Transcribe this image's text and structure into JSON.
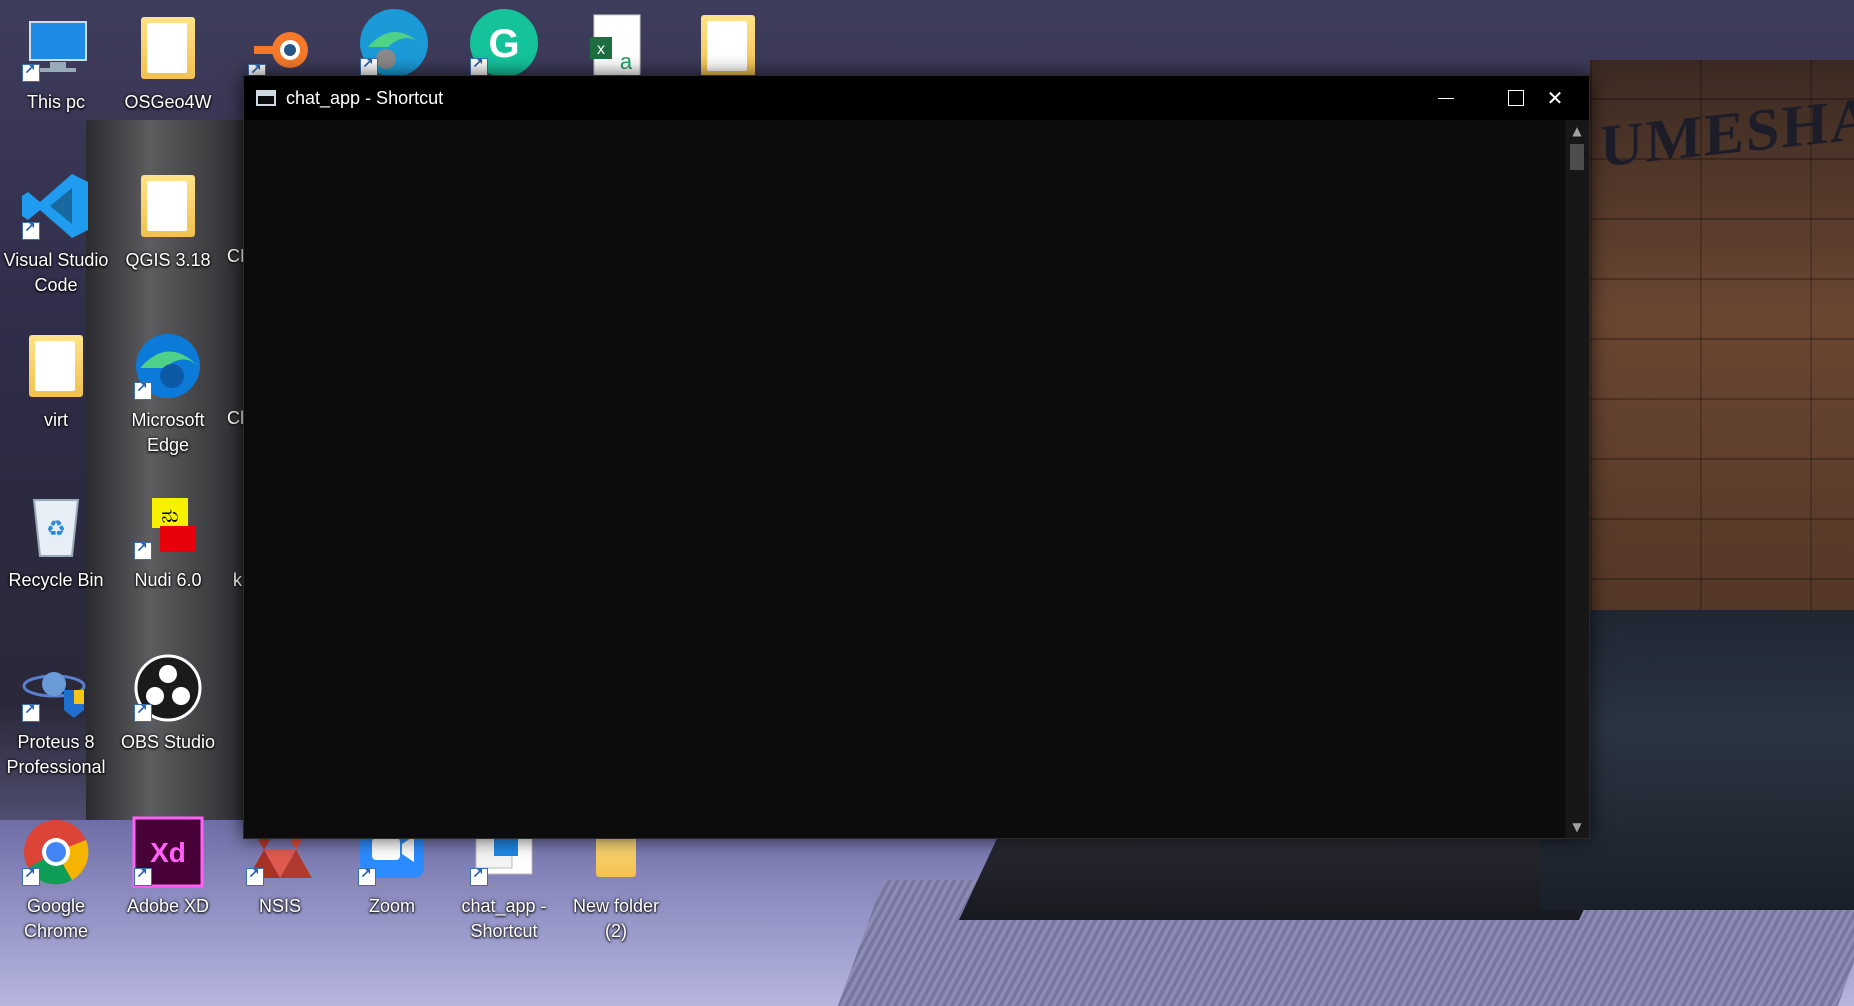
{
  "desktop": {
    "wallpaper_text": "UMESHA R",
    "icons": [
      {
        "label": "This pc",
        "icon": "monitor-icon"
      },
      {
        "label": "OSGeo4W",
        "icon": "folder-icon"
      },
      {
        "label": "Visual Studio Code",
        "icon": "vscode-icon"
      },
      {
        "label": "QGIS 3.18",
        "icon": "folder-icon"
      },
      {
        "label": "virt",
        "icon": "folder-icon"
      },
      {
        "label": "Microsoft Edge",
        "icon": "edge-icon"
      },
      {
        "label": "Recycle Bin",
        "icon": "recycle-bin-icon"
      },
      {
        "label": "Nudi 6.0",
        "icon": "nudi-icon"
      },
      {
        "label": "Proteus 8 Professional",
        "icon": "proteus-icon"
      },
      {
        "label": "OBS Studio",
        "icon": "obs-icon"
      },
      {
        "label": "Google Chrome",
        "icon": "chrome-icon"
      },
      {
        "label": "Adobe XD",
        "icon": "adobe-xd-icon"
      },
      {
        "label": "NSIS",
        "icon": "nsis-icon"
      },
      {
        "label": "Zoom",
        "icon": "zoom-icon"
      },
      {
        "label": "chat_app - Shortcut",
        "icon": "shortcut-file-icon"
      },
      {
        "label": "New folder (2)",
        "icon": "folder-icon"
      }
    ],
    "partial_labels": [
      "CE",
      "Ch",
      "k"
    ],
    "top_row_icons": [
      "blender-icon",
      "edge-beta-icon",
      "grammarly-icon",
      "excel-icon",
      "folder-icon"
    ]
  },
  "window": {
    "title": "chat_app - Shortcut",
    "minimize_glyph": "",
    "maximize_glyph": "",
    "close_glyph": "✕",
    "scroll_up_glyph": "▲",
    "scroll_down_glyph": "▼"
  },
  "colors": {
    "console_bg": "#0c0c0c",
    "titlebar_bg": "#000000",
    "text": "#ffffff"
  }
}
